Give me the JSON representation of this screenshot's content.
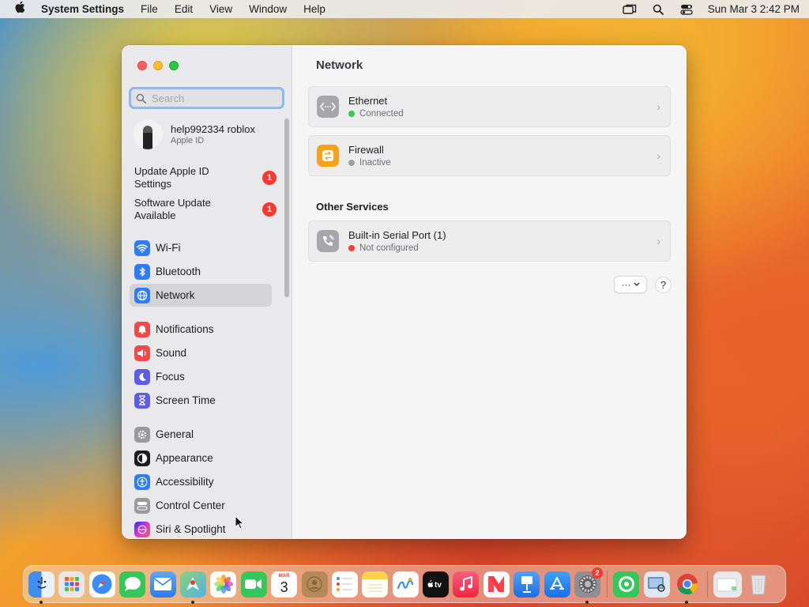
{
  "menubar": {
    "app_name": "System Settings",
    "menus": [
      "File",
      "Edit",
      "View",
      "Window",
      "Help"
    ],
    "clock": "Sun Mar 3  2:42 PM"
  },
  "sidebar": {
    "search_placeholder": "Search",
    "account": {
      "name": "help992334 roblox",
      "subtitle": "Apple ID"
    },
    "alerts": [
      {
        "label": "Update Apple ID Settings",
        "badge": "1"
      },
      {
        "label": "Software Update Available",
        "badge": "1"
      }
    ],
    "items": [
      {
        "label": "Wi-Fi",
        "icon": "wifi-icon",
        "color": "#2f7cf6"
      },
      {
        "label": "Bluetooth",
        "icon": "bluetooth-icon",
        "color": "#2f7cf6"
      },
      {
        "label": "Network",
        "icon": "globe-icon",
        "color": "#2f7cf6",
        "selected": true
      },
      {
        "label": "Notifications",
        "icon": "bell-icon",
        "color": "#f0484b"
      },
      {
        "label": "Sound",
        "icon": "speaker-icon",
        "color": "#f0484b"
      },
      {
        "label": "Focus",
        "icon": "moon-icon",
        "color": "#5e5ce6"
      },
      {
        "label": "Screen Time",
        "icon": "hourglass-icon",
        "color": "#5e5ce6"
      },
      {
        "label": "General",
        "icon": "gear-icon",
        "color": "#9a9a9e"
      },
      {
        "label": "Appearance",
        "icon": "appearance-icon",
        "color": "#1d1d1f"
      },
      {
        "label": "Accessibility",
        "icon": "accessibility-icon",
        "color": "#2f7cf6"
      },
      {
        "label": "Control Center",
        "icon": "control-center-icon",
        "color": "#9a9a9e"
      },
      {
        "label": "Siri & Spotlight",
        "icon": "siri-icon",
        "color": "#b53bd6"
      }
    ]
  },
  "main": {
    "title": "Network",
    "services": [
      {
        "name": "Ethernet",
        "status": "Connected",
        "status_color": "#34c759",
        "icon": "ethernet-icon"
      },
      {
        "name": "Firewall",
        "status": "Inactive",
        "status_color": "#a0a0a4",
        "icon": "firewall-icon"
      }
    ],
    "other_services_heading": "Other Services",
    "other_services": [
      {
        "name": "Built-in Serial Port (1)",
        "status": "Not configured",
        "status_color": "#ff3b30",
        "icon": "phone-icon"
      }
    ],
    "more_button": "···",
    "help_button": "?"
  },
  "dock": {
    "apps": [
      {
        "name": "Finder",
        "icon": "finder-icon",
        "color": "#3d8ef0",
        "running": true
      },
      {
        "name": "Launchpad",
        "icon": "launchpad-icon",
        "color": "#e8e8ea"
      },
      {
        "name": "Safari",
        "icon": "safari-icon",
        "color": "#3a8df5"
      },
      {
        "name": "Messages",
        "icon": "messages-icon",
        "color": "#34c759"
      },
      {
        "name": "Mail",
        "icon": "mail-icon",
        "color": "#3a8df5"
      },
      {
        "name": "Maps",
        "icon": "maps-icon",
        "color": "#5cbf6a",
        "running": true
      },
      {
        "name": "Photos",
        "icon": "photos-icon",
        "color": "#f6f6f6"
      },
      {
        "name": "FaceTime",
        "icon": "facetime-icon",
        "color": "#34c759"
      },
      {
        "name": "Calendar",
        "icon": "calendar-icon",
        "color": "#ffffff",
        "text": "3",
        "sub": "MAR"
      },
      {
        "name": "Contacts",
        "icon": "contacts-icon",
        "color": "#b48a58"
      },
      {
        "name": "Reminders",
        "icon": "reminders-icon",
        "color": "#ffffff"
      },
      {
        "name": "Notes",
        "icon": "notes-icon",
        "color": "#fbd24c"
      },
      {
        "name": "Freeform",
        "icon": "freeform-icon",
        "color": "#ffffff"
      },
      {
        "name": "TV",
        "icon": "tv-icon",
        "color": "#111111",
        "text": "tv"
      },
      {
        "name": "Music",
        "icon": "music-icon",
        "color": "#fa3c55"
      },
      {
        "name": "News",
        "icon": "news-icon",
        "color": "#fa3c4a"
      },
      {
        "name": "Keynote",
        "icon": "keynote-icon",
        "color": "#2a7cf0"
      },
      {
        "name": "App Store",
        "icon": "appstore-icon",
        "color": "#2a7cf0"
      },
      {
        "name": "System Settings",
        "icon": "system-settings-icon",
        "color": "#8e8e93",
        "badge": "2",
        "running": true
      }
    ],
    "apps_right": [
      {
        "name": "Find My",
        "icon": "findmy-icon",
        "color": "#34c759"
      },
      {
        "name": "Preview",
        "icon": "preview-icon",
        "color": "#6d8fb8"
      },
      {
        "name": "Chrome",
        "icon": "chrome-icon",
        "color": "#ffffff",
        "running": true
      }
    ],
    "trash": [
      {
        "name": "Downloads",
        "icon": "downloads-stack-icon",
        "color": "#e9e9ec"
      },
      {
        "name": "Trash",
        "icon": "trash-icon",
        "color": "#dcdcdf"
      }
    ]
  }
}
